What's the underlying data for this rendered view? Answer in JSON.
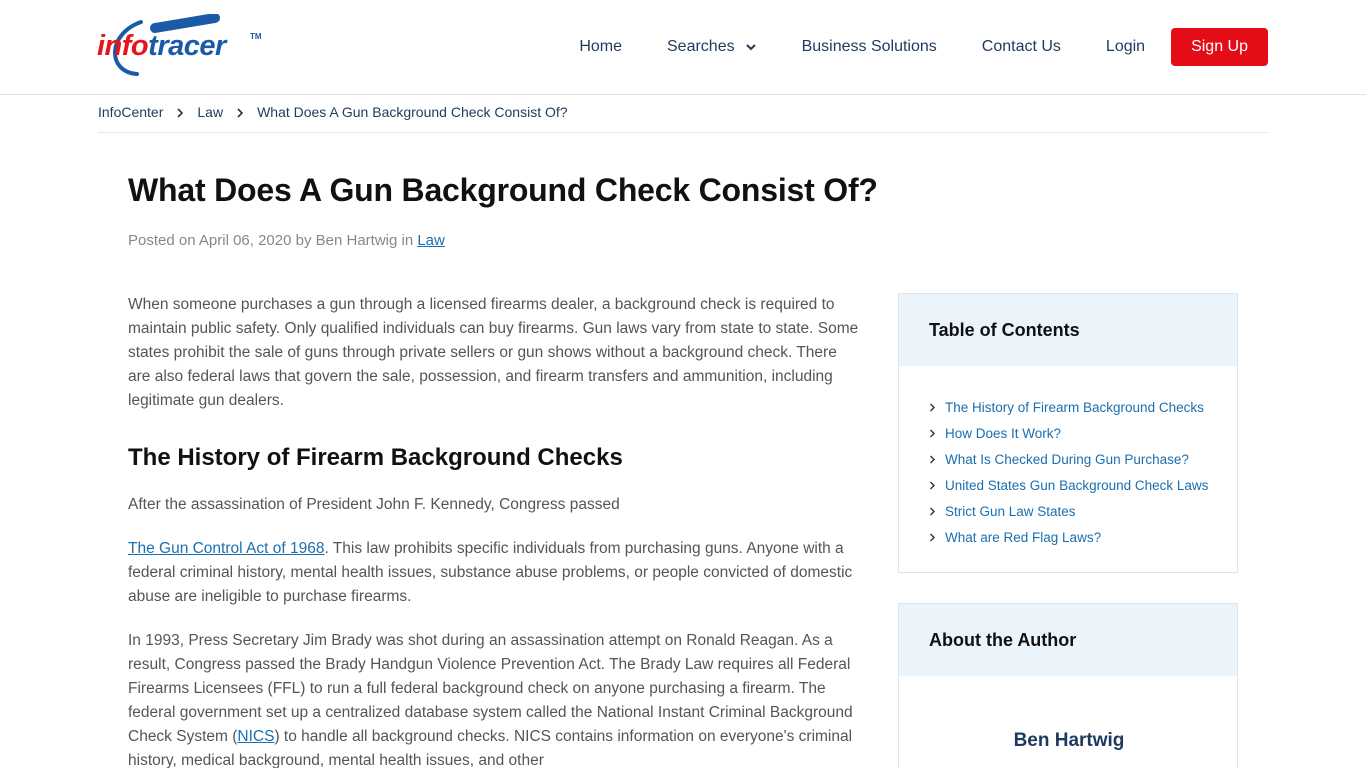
{
  "header": {
    "logo": {
      "part1": "info",
      "part2": "tracer",
      "tm": "TM"
    },
    "nav": {
      "home": "Home",
      "searches": "Searches",
      "business": "Business Solutions",
      "contact": "Contact Us",
      "login": "Login",
      "signup": "Sign Up"
    }
  },
  "breadcrumb": {
    "items": [
      "InfoCenter",
      "Law",
      "What Does A Gun Background Check Consist Of?"
    ]
  },
  "article": {
    "title": "What Does A Gun Background Check Consist Of?",
    "meta": {
      "prefix": "Posted on April 06, 2020 by Ben Hartwig in ",
      "category": "Law"
    },
    "intro": "When someone purchases a gun through a licensed firearms dealer, a background check is required to maintain public safety. Only qualified individuals can buy firearms. Gun laws vary from state to state. Some states prohibit the sale of guns through private sellers or gun shows without a background check. There are also federal laws that govern the sale, possession, and firearm transfers and ammunition, including legitimate gun dealers.",
    "h2": "The History of Firearm Background Checks",
    "p1": "After the assassination of President John F. Kennedy, Congress passed",
    "p2_link": "The Gun Control Act of 1968",
    "p2_rest": ". This law prohibits specific individuals from purchasing guns. Anyone with a federal criminal history, mental health issues, substance abuse problems, or people convicted of domestic abuse are ineligible to purchase firearms.",
    "p3_a": "In 1993, Press Secretary Jim Brady was shot during an assassination attempt on Ronald Reagan. As a result, Congress passed the Brady Handgun Violence Prevention Act. The Brady Law requires all Federal Firearms Licensees (FFL) to run a full federal background check on anyone purchasing a firearm. The federal government set up a centralized database system called the National Instant Criminal Background Check System (",
    "p3_link": "NICS",
    "p3_b": ") to handle all background checks. NICS contains information on everyone's criminal history, medical background, mental health issues, and other"
  },
  "sidebar": {
    "toc": {
      "title": "Table of Contents",
      "items": [
        "The History of Firearm Background Checks",
        "How Does It Work?",
        "What Is Checked During Gun Purchase?",
        "United States Gun Background Check Laws",
        "Strict Gun Law States",
        "What are Red Flag Laws?"
      ]
    },
    "author": {
      "title": "About the Author",
      "name": "Ben Hartwig"
    }
  },
  "colors": {
    "brand_red": "#e40d17",
    "brand_blue": "#1a5aa6",
    "link": "#1a6fb0",
    "panel_bg": "#ebf4fb"
  }
}
